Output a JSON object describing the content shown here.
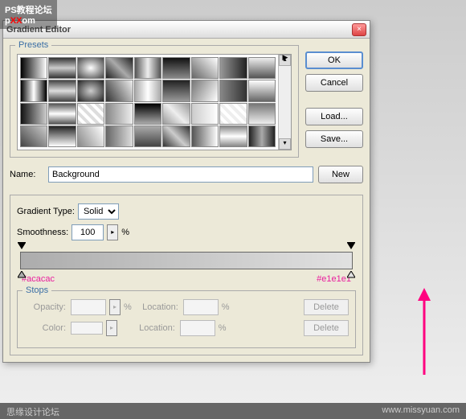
{
  "overlay": {
    "line1": "PS教程论坛",
    "line2_prefix": "p",
    "line2_red": "XX",
    "line2_suffix": "om"
  },
  "dialog": {
    "title": "Gradient Editor",
    "presets_label": "Presets",
    "side": {
      "ok": "OK",
      "cancel": "Cancel",
      "load": "Load...",
      "save": "Save..."
    },
    "name_label": "Name:",
    "name_value": "Background",
    "new_btn": "New",
    "gradient_type_label": "Gradient Type:",
    "gradient_type_value": "Solid",
    "smoothness_label": "Smoothness:",
    "smoothness_value": "100",
    "percent": "%",
    "annot_left": "#acacac",
    "annot_right": "#e1e1e1",
    "stops_label": "Stops",
    "opacity_label": "Opacity:",
    "color_label": "Color:",
    "location_label": "Location:",
    "delete_label": "Delete"
  },
  "status": {
    "left": "思缘设计论坛",
    "right": "www.missyuan.com"
  },
  "swatches": [
    "linear-gradient(to right,#000,#fff)",
    "linear-gradient(to bottom,#333,#ccc,#333)",
    "radial-gradient(#fff,#444)",
    "linear-gradient(45deg,#222,#aaa,#222)",
    "linear-gradient(to right,#555,#eee,#555)",
    "linear-gradient(to bottom,#111,#888)",
    "linear-gradient(45deg,#666,#fff)",
    "linear-gradient(to right,#999,#222)",
    "linear-gradient(to bottom,#eee,#555)",
    "linear-gradient(to right,#000,#fff,#000)",
    "linear-gradient(to bottom,#444,#ddd,#444)",
    "radial-gradient(#ccc,#222)",
    "linear-gradient(60deg,#333,#eee)",
    "linear-gradient(to right,#aaa,#fff,#aaa)",
    "linear-gradient(to bottom,#222,#999)",
    "linear-gradient(120deg,#777,#fff)",
    "linear-gradient(to right,#888,#333)",
    "linear-gradient(to bottom,#fff,#666)",
    "linear-gradient(to right,#111,#ccc)",
    "linear-gradient(to bottom,#555,#fff,#555)",
    "repeating-linear-gradient(45deg,#ddd 0 4px,#fff 4px 8px)",
    "linear-gradient(to right,#888,#eee)",
    "linear-gradient(to bottom,#000,#aaa)",
    "linear-gradient(45deg,#999,#eee,#999)",
    "linear-gradient(to right,#ccc,#fff)",
    "repeating-linear-gradient(45deg,#eee 0 4px,#fff 4px 8px)",
    "linear-gradient(to bottom,#777,#eee)",
    "linear-gradient(45deg,#444,#ccc)",
    "linear-gradient(to bottom,#222,#fff)",
    "linear-gradient(60deg,#888,#fff)",
    "linear-gradient(to right,#666,#ddd)",
    "linear-gradient(to bottom,#aaa,#444)",
    "linear-gradient(45deg,#333,#ccc,#333)",
    "linear-gradient(to right,#555,#fff)",
    "linear-gradient(to bottom,#888,#fff,#888)",
    "linear-gradient(to right,#222,#aaa,#222)"
  ]
}
